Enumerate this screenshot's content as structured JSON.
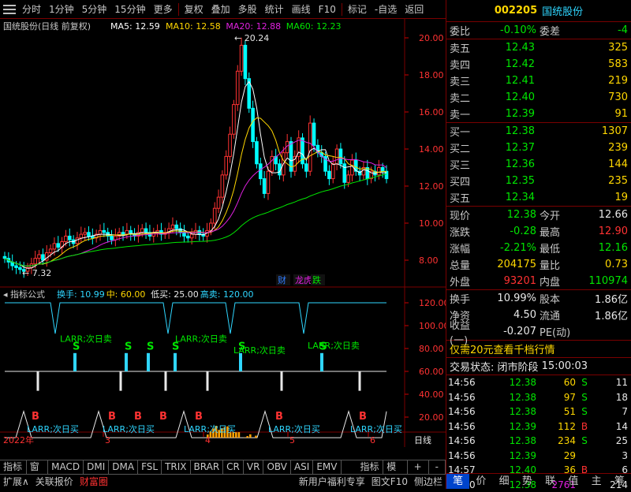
{
  "toolbar": {
    "items": [
      "分时",
      "1分钟",
      "5分钟",
      "15分钟",
      "更多",
      "复权",
      "叠加",
      "多股",
      "统计",
      "画线",
      "F10",
      "标记",
      "-自选",
      "返回"
    ]
  },
  "main_chart": {
    "title": "国统股份(日线 前复权)",
    "ma": [
      {
        "label": "MA5: 12.59",
        "color": "#ffffff"
      },
      {
        "label": "MA10: 12.58",
        "color": "#ffd700"
      },
      {
        "label": "MA20: 12.88",
        "color": "#e020e0"
      },
      {
        "label": "MA60: 12.23",
        "color": "#00e600"
      }
    ],
    "high_label": "20.24",
    "low_label": "7.32",
    "tags": [
      "财",
      "龙虎",
      "跌"
    ],
    "axis_ticks": [
      "20.00",
      "18.00",
      "16.00",
      "14.00",
      "12.00",
      "10.00",
      "8.00"
    ]
  },
  "indicator": {
    "title": "指标公式",
    "params": [
      {
        "label": "换手: 10.99",
        "color": "#2fd6ff"
      },
      {
        "label": "中: 60.00",
        "color": "#ffd700"
      },
      {
        "label": "低买: 25.00",
        "color": "#e8e8e8"
      },
      {
        "label": "高卖: 120.00",
        "color": "#2fd6ff"
      }
    ],
    "axis_ticks": [
      "120.00",
      "100.00",
      "80.00",
      "60.00",
      "40.00",
      "20.00"
    ],
    "sell_labels": [
      "LARR;次日卖",
      "LARR;次日卖",
      "LARR;次日卖",
      "LARR;次日卖"
    ],
    "buy_labels": [
      "LARR;次日买",
      "LARR;次日买",
      "LARR;次日买",
      "LARR;次日买",
      "LARR;次日买"
    ],
    "s_mark": "S",
    "b_mark": "B"
  },
  "date_axis": {
    "year": "2022年",
    "months": [
      "3",
      "4",
      "5",
      "6"
    ],
    "period": "日线"
  },
  "tabs_row1": [
    "指标A",
    "窗口",
    "MACD",
    "DMI",
    "DMA",
    "FSL",
    "TRIX",
    "BRAR",
    "CR",
    "VR",
    "OBV",
    "ASI",
    "EMV",
    "指标B",
    "模 板"
  ],
  "tabs_row1_extra": [
    "+",
    "-"
  ],
  "tabs_row2": [
    "扩展∧",
    "关联报价",
    "财富圈"
  ],
  "tabs_row2_right": [
    "新用户福利专享",
    "图文F10",
    "侧边栏"
  ],
  "quote": {
    "code": "002205",
    "name": "国统股份",
    "webi": {
      "label": "委比",
      "value": "-0.10%",
      "label2": "委差",
      "value2": "-4"
    },
    "sells": [
      {
        "label": "卖五",
        "price": "12.43",
        "vol": "325"
      },
      {
        "label": "卖四",
        "price": "12.42",
        "vol": "583"
      },
      {
        "label": "卖三",
        "price": "12.41",
        "vol": "219"
      },
      {
        "label": "卖二",
        "price": "12.40",
        "vol": "730"
      },
      {
        "label": "卖一",
        "price": "12.39",
        "vol": "91"
      }
    ],
    "buys": [
      {
        "label": "买一",
        "price": "12.38",
        "vol": "1307"
      },
      {
        "label": "买二",
        "price": "12.37",
        "vol": "239"
      },
      {
        "label": "买三",
        "price": "12.36",
        "vol": "144"
      },
      {
        "label": "买四",
        "price": "12.35",
        "vol": "235"
      },
      {
        "label": "买五",
        "price": "12.34",
        "vol": "19"
      }
    ],
    "stats1": [
      {
        "l1": "现价",
        "v1": "12.38",
        "c1": "green",
        "l2": "今开",
        "v2": "12.66",
        "c2": "white"
      },
      {
        "l1": "涨跌",
        "v1": "-0.28",
        "c1": "green",
        "l2": "最高",
        "v2": "12.90",
        "c2": "red"
      },
      {
        "l1": "涨幅",
        "v1": "-2.21%",
        "c1": "green",
        "l2": "最低",
        "v2": "12.16",
        "c2": "green"
      },
      {
        "l1": "总量",
        "v1": "204175",
        "c1": "yellow",
        "l2": "量比",
        "v2": "0.73",
        "c2": "yellow"
      },
      {
        "l1": "外盘",
        "v1": "93201",
        "c1": "red",
        "l2": "内盘",
        "v2": "110974",
        "c2": "green"
      }
    ],
    "stats2": [
      {
        "l1": "换手",
        "v1": "10.99%",
        "c1": "white",
        "l2": "股本",
        "v2": "1.86亿",
        "c2": "white"
      },
      {
        "l1": "净资",
        "v1": "4.50",
        "c1": "white",
        "l2": "流通",
        "v2": "1.86亿",
        "c2": "white"
      },
      {
        "l1": "收益(一)",
        "v1": "-0.207",
        "c1": "white",
        "l2": "PE(动)",
        "v2": "",
        "c2": "white"
      }
    ],
    "banner": "仅需20元查看千档行情",
    "status_label": "交易状态: 闭市阶段",
    "status_time": "15:00:03",
    "trades": [
      {
        "t": "14:56",
        "p": "12.38",
        "pc": "green",
        "q": "60",
        "s": "S",
        "sc": "green",
        "n": "11"
      },
      {
        "t": "14:56",
        "p": "12.38",
        "pc": "green",
        "q": "97",
        "s": "S",
        "sc": "green",
        "n": "18"
      },
      {
        "t": "14:56",
        "p": "12.38",
        "pc": "green",
        "q": "51",
        "s": "S",
        "sc": "green",
        "n": "7"
      },
      {
        "t": "14:56",
        "p": "12.39",
        "pc": "green",
        "q": "112",
        "s": "B",
        "sc": "red",
        "n": "14"
      },
      {
        "t": "14:56",
        "p": "12.38",
        "pc": "green",
        "q": "234",
        "s": "S",
        "sc": "green",
        "n": "25"
      },
      {
        "t": "14:56",
        "p": "12.39",
        "pc": "green",
        "q": "29",
        "s": "",
        "sc": "white",
        "n": "3"
      },
      {
        "t": "14:57",
        "p": "12.40",
        "pc": "green",
        "q": "36",
        "s": "B",
        "sc": "red",
        "n": "6"
      },
      {
        "t": "15:00",
        "p": "12.38",
        "pc": "green",
        "q": "2761",
        "s": "",
        "sc": "magenta",
        "n": "214"
      }
    ],
    "tabs": [
      "笔",
      "价",
      "细",
      "势",
      "联",
      "值",
      "主",
      "筹"
    ]
  }
}
